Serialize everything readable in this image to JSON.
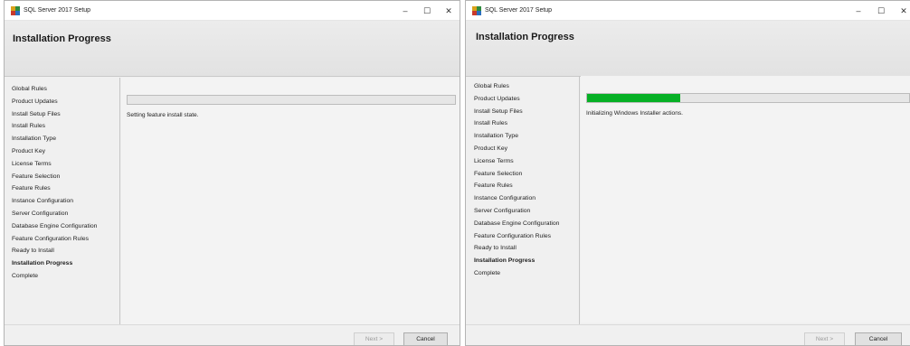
{
  "windows": [
    {
      "title": "SQL Server 2017 Setup",
      "header_title": "Installation Progress",
      "nav_items": [
        "Global Rules",
        "Product Updates",
        "Install Setup Files",
        "Install Rules",
        "Installation Type",
        "Product Key",
        "License Terms",
        "Feature Selection",
        "Feature Rules",
        "Instance Configuration",
        "Server Configuration",
        "Database Engine Configuration",
        "Feature Configuration Rules",
        "Ready to Install",
        "Installation Progress",
        "Complete"
      ],
      "active_nav_item": "Installation Progress",
      "progress_fraction": 0.0,
      "status_text": "Setting feature install state.",
      "buttons": {
        "next": "Next >",
        "cancel": "Cancel"
      },
      "controls": {
        "minimize": "–",
        "maximize": "☐",
        "close": "✕"
      }
    },
    {
      "title": "SQL Server 2017 Setup",
      "header_title": "Installation Progress",
      "nav_items": [
        "Global Rules",
        "Product Updates",
        "Install Setup Files",
        "Install Rules",
        "Installation Type",
        "Product Key",
        "License Terms",
        "Feature Selection",
        "Feature Rules",
        "Instance Configuration",
        "Server Configuration",
        "Database Engine Configuration",
        "Feature Configuration Rules",
        "Ready to Install",
        "Installation Progress",
        "Complete"
      ],
      "active_nav_item": "Installation Progress",
      "progress_fraction": 0.29,
      "status_text": "Initializing Windows Installer actions.",
      "buttons": {
        "next": "Next >",
        "cancel": "Cancel"
      },
      "controls": {
        "minimize": "–",
        "maximize": "☐",
        "close": "✕"
      }
    }
  ],
  "colors": {
    "progress_fill": "#06b025",
    "header_bg": "#e6e6e6",
    "window_bg": "#f0f0f0"
  }
}
